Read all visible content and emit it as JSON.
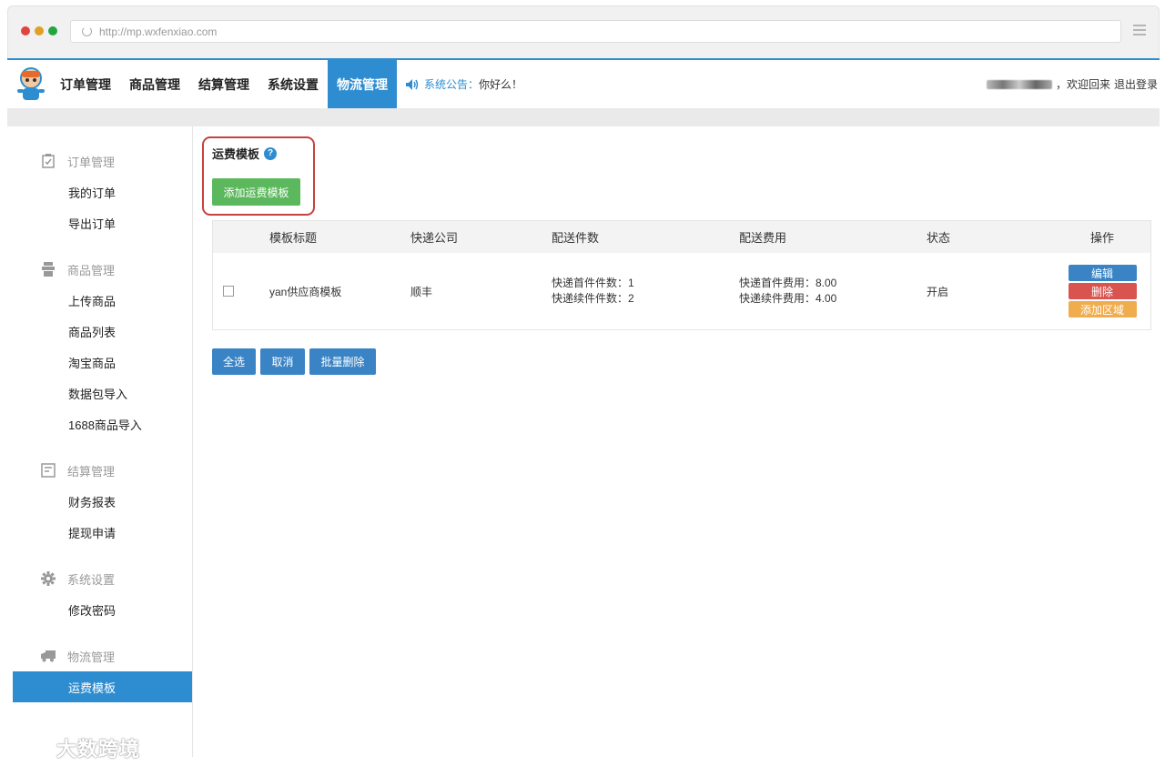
{
  "browser": {
    "url": "http://mp.wxfenxiao.com",
    "dot_colors": [
      "#e0443e",
      "#dea123",
      "#23a640"
    ]
  },
  "topnav": {
    "items": [
      {
        "label": "订单管理"
      },
      {
        "label": "商品管理"
      },
      {
        "label": "结算管理"
      },
      {
        "label": "系统设置"
      },
      {
        "label": "物流管理",
        "active": true
      }
    ],
    "notice_label": "系统公告：",
    "notice_message": "你好么！",
    "welcome": "，欢迎回来",
    "logout": "退出登录"
  },
  "sidebar": {
    "groups": [
      {
        "title": "订单管理",
        "icon": "clipboard-check-icon",
        "items": [
          "我的订单",
          "导出订单"
        ]
      },
      {
        "title": "商品管理",
        "icon": "goods-icon",
        "items": [
          "上传商品",
          "商品列表",
          "淘宝商品",
          "数据包导入",
          "1688商品导入"
        ]
      },
      {
        "title": "结算管理",
        "icon": "ledger-icon",
        "items": [
          "财务报表",
          "提现申请"
        ]
      },
      {
        "title": "系统设置",
        "icon": "gear-icon",
        "items": [
          "修改密码"
        ]
      },
      {
        "title": "物流管理",
        "icon": "truck-icon",
        "items": [
          "运费模板"
        ]
      }
    ],
    "active_item": "运费模板"
  },
  "main": {
    "section_title": "运费模板",
    "help_icon": "question-icon",
    "add_button": "添加运费模板",
    "table": {
      "headers": [
        "",
        "模板标题",
        "快递公司",
        "配送件数",
        "配送费用",
        "状态",
        "操作"
      ],
      "rows": [
        {
          "title": "yan供应商模板",
          "company": "顺丰",
          "count_first": "快递首件件数：1",
          "count_next": "快递续件件数：2",
          "fee_first": "快递首件费用：8.00",
          "fee_next": "快递续件费用：4.00",
          "status": "开启",
          "actions": {
            "edit": "编辑",
            "delete": "删除",
            "add_region": "添加区域"
          }
        }
      ]
    },
    "bulk": {
      "select_all": "全选",
      "cancel": "取消",
      "batch_delete": "批量删除"
    }
  },
  "colors": {
    "primary": "#2e8dd0",
    "success": "#5cb85c",
    "danger": "#d9534f",
    "warning": "#f0ad4e",
    "highlight_border": "#c6423e"
  },
  "watermark": {
    "text": "大数跨境"
  }
}
